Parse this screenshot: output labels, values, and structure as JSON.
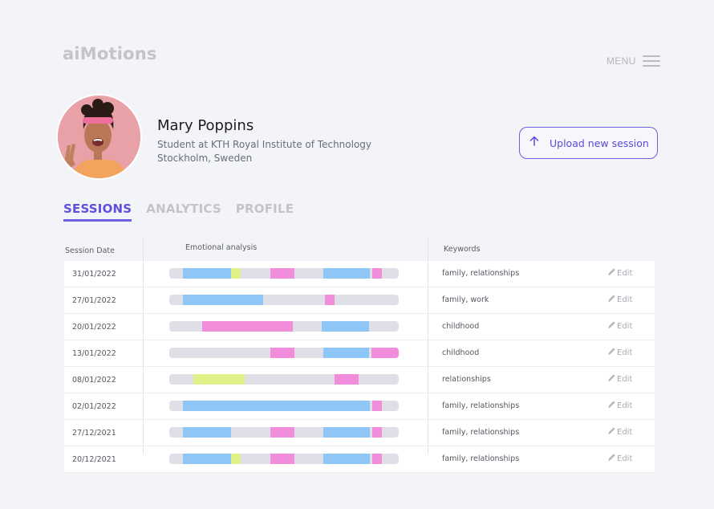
{
  "app": {
    "logo": "aiMotions"
  },
  "menu": {
    "label": "MENU",
    "icon": "hamburger-icon"
  },
  "profile": {
    "name": "Mary Poppins",
    "occupation": "Student at KTH Royal Institute of Technology",
    "location": "Stockholm, Sweden"
  },
  "upload": {
    "label": "Upload new session",
    "icon": "arrow-up-icon"
  },
  "tabs": [
    {
      "label": "SESSIONS",
      "active": true
    },
    {
      "label": "ANALYTICS",
      "active": false
    },
    {
      "label": "PROFILE",
      "active": false
    }
  ],
  "table": {
    "headers": {
      "date": "Session Date",
      "analysis": "Emotional analysis",
      "keywords": "Keywords"
    },
    "edit_label": "Edit",
    "emotion_colors": {
      "blue": "#8ec6f7",
      "pink": "#f28ddc",
      "lime": "#dff28a",
      "track": "#dfe0e7"
    },
    "rows": [
      {
        "date": "31/01/2022",
        "keywords": "family, relationships",
        "segments": [
          [
            0.06,
            0.27,
            "blue"
          ],
          [
            0.27,
            0.31,
            "lime"
          ],
          [
            0.44,
            0.545,
            "pink"
          ],
          [
            0.67,
            0.875,
            "blue"
          ],
          [
            0.885,
            0.925,
            "pink"
          ]
        ]
      },
      {
        "date": "27/01/2022",
        "keywords": "family, work",
        "segments": [
          [
            0.06,
            0.41,
            "blue"
          ],
          [
            0.68,
            0.72,
            "pink"
          ]
        ]
      },
      {
        "date": "20/01/2022",
        "keywords": "childhood",
        "segments": [
          [
            0.145,
            0.54,
            "pink"
          ],
          [
            0.665,
            0.87,
            "blue"
          ]
        ]
      },
      {
        "date": "13/01/2022",
        "keywords": "childhood",
        "segments": [
          [
            0.44,
            0.545,
            "pink"
          ],
          [
            0.67,
            0.87,
            "blue"
          ],
          [
            0.88,
            1.0,
            "pink"
          ]
        ]
      },
      {
        "date": "08/01/2022",
        "keywords": "relationships",
        "segments": [
          [
            0.105,
            0.33,
            "lime"
          ],
          [
            0.72,
            0.825,
            "pink"
          ]
        ]
      },
      {
        "date": "02/01/2022",
        "keywords": "family, relationships",
        "segments": [
          [
            0.06,
            0.875,
            "blue"
          ],
          [
            0.885,
            0.925,
            "pink"
          ]
        ]
      },
      {
        "date": "27/12/2021",
        "keywords": "family, relationships",
        "segments": [
          [
            0.06,
            0.27,
            "blue"
          ],
          [
            0.44,
            0.545,
            "pink"
          ],
          [
            0.67,
            0.875,
            "blue"
          ],
          [
            0.885,
            0.925,
            "pink"
          ]
        ]
      },
      {
        "date": "20/12/2021",
        "keywords": "family, relationships",
        "segments": [
          [
            0.06,
            0.27,
            "blue"
          ],
          [
            0.27,
            0.31,
            "lime"
          ],
          [
            0.44,
            0.545,
            "pink"
          ],
          [
            0.67,
            0.875,
            "blue"
          ],
          [
            0.885,
            0.925,
            "pink"
          ]
        ]
      }
    ]
  }
}
